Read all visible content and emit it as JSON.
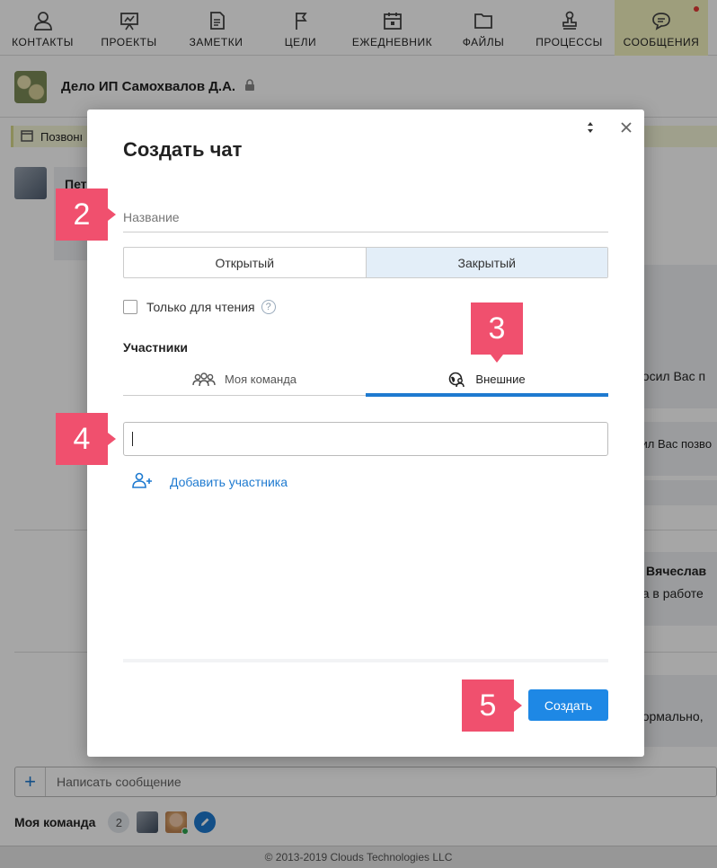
{
  "nav": {
    "items": [
      {
        "label": "КОНТАКТЫ",
        "icon": "person-icon"
      },
      {
        "label": "ПРОЕКТЫ",
        "icon": "presentation-icon"
      },
      {
        "label": "ЗАМЕТКИ",
        "icon": "note-icon"
      },
      {
        "label": "ЦЕЛИ",
        "icon": "flag-icon"
      },
      {
        "label": "ЕЖЕДНЕВНИК",
        "icon": "calendar-icon"
      },
      {
        "label": "ФАЙЛЫ",
        "icon": "folder-icon"
      },
      {
        "label": "ПРОЦЕССЫ",
        "icon": "stamp-icon"
      },
      {
        "label": "СООБЩЕНИЯ",
        "icon": "chat-icon"
      }
    ],
    "active": "СООБЩЕНИЯ",
    "active_color": "#f3f3bf",
    "notification_color": "#e53935"
  },
  "case": {
    "title": "Дело ИП Самохвалов Д.А."
  },
  "background": {
    "call_bar": "Позвонı",
    "sender_fragment": "Пет",
    "snippet_1": "росил Вас п",
    "snippet_2": "сил Вас позво",
    "sender_2": "я Вячеслав",
    "snippet_3": "на в работе",
    "snippet_4": "нормально,"
  },
  "composer": {
    "plus": "+",
    "placeholder": "Написать сообщение"
  },
  "team": {
    "label": "Моя команда",
    "count": "2"
  },
  "footer": {
    "copyright": "© 2013-2019 Clouds Technologies LLC"
  },
  "modal": {
    "title": "Создать чат",
    "name_placeholder": "Название",
    "type_options": [
      "Открытый",
      "Закрытый"
    ],
    "type_selected": "Закрытый",
    "readonly_label": "Только для чтения",
    "participants_label": "Участники",
    "tabs": [
      "Моя команда",
      "Внешние"
    ],
    "active_tab": "Внешние",
    "search_value": "",
    "add_participant": "Добавить участника",
    "create_button": "Создать",
    "accent_color": "#1e88e5"
  },
  "callouts": [
    "2",
    "3",
    "4",
    "5"
  ],
  "callout_color": "#f0506e"
}
